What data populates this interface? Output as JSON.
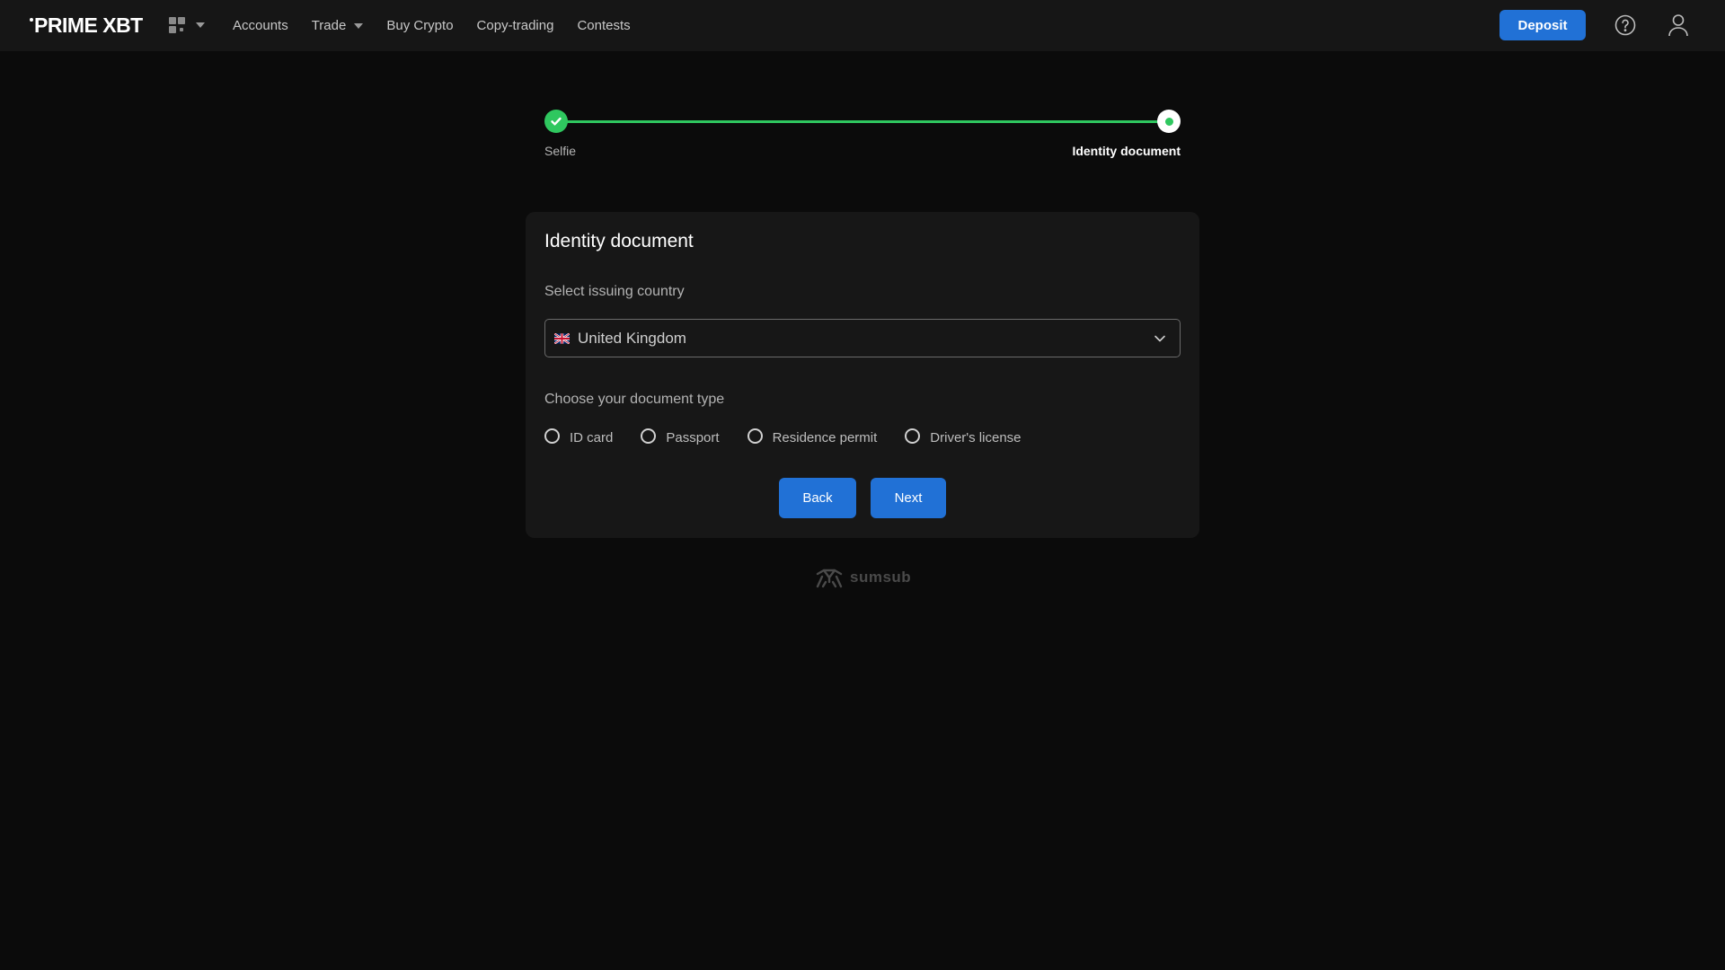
{
  "header": {
    "logo": "PRIME XBT",
    "nav": [
      {
        "label": "Accounts"
      },
      {
        "label": "Trade"
      },
      {
        "label": "Buy Crypto"
      },
      {
        "label": "Copy-trading"
      },
      {
        "label": "Contests"
      }
    ],
    "deposit_label": "Deposit",
    "icons": {
      "apps": "grid-icon",
      "help": "help-circle-icon",
      "user": "user-icon"
    }
  },
  "stepper": {
    "steps": [
      {
        "label": "Selfie",
        "status": "done"
      },
      {
        "label": "Identity document",
        "status": "current"
      }
    ]
  },
  "form": {
    "title": "Identity document",
    "country_label": "Select issuing country",
    "country_value": "United Kingdom",
    "doc_type_label": "Choose your document type",
    "doc_types": [
      {
        "label": "ID card"
      },
      {
        "label": "Passport"
      },
      {
        "label": "Residence permit"
      },
      {
        "label": "Driver's license"
      }
    ],
    "back_label": "Back",
    "next_label": "Next"
  },
  "footer": {
    "brand": "sumsub"
  },
  "colors": {
    "accent": "#2171d6",
    "success": "#2fc75f",
    "background": "#0b0b0b",
    "card": "#171717"
  }
}
